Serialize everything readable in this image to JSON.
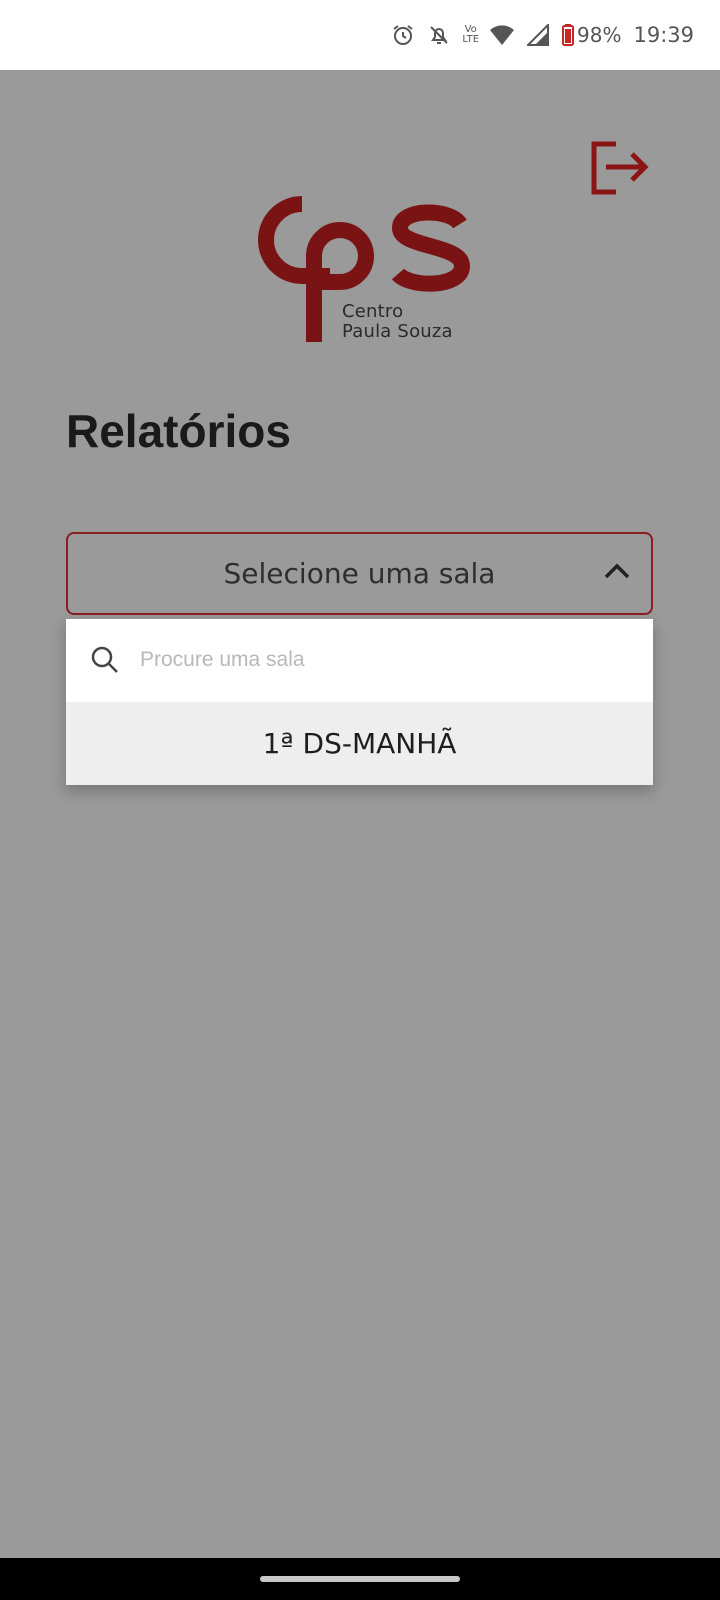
{
  "status_bar": {
    "volte_top": "Vo",
    "volte_bottom": "LTE",
    "battery": "98%",
    "time": "19:39",
    "icons": [
      "alarm-icon",
      "notifications-off-icon",
      "volte-icon",
      "wifi-icon",
      "signal-icon",
      "battery-icon"
    ]
  },
  "header": {
    "logout_icon": "logout-icon",
    "logo": {
      "line1": "Centro",
      "line2": "Paula Souza",
      "color": "#7a1414"
    }
  },
  "page": {
    "title": "Relatórios"
  },
  "room_select": {
    "label": "Selecione uma sala",
    "chevron_icon": "chevron-up-icon",
    "search_placeholder": "Procure uma sala",
    "options": [
      "1ª DS-MANHÃ"
    ]
  },
  "colors": {
    "accent": "#8b1e1e",
    "background": "#9a9a9a"
  }
}
